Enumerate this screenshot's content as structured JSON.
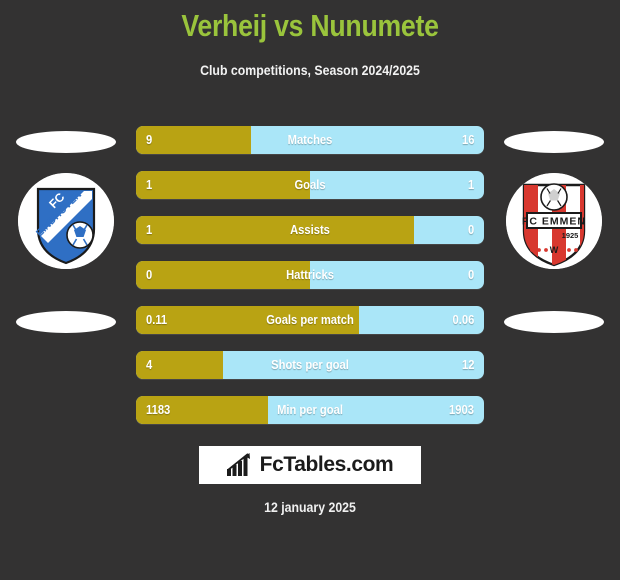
{
  "header": {
    "title": "Verheij vs Nunumete",
    "subtitle": "Club competitions, Season 2024/2025",
    "title_color": "#9ac43c"
  },
  "teams": {
    "left": {
      "name": "FC EINDHOVEN",
      "crest": "fc-eindhoven-crest"
    },
    "right": {
      "name": "FC EMMEN",
      "founded": "1925",
      "crest": "fc-emmen-crest"
    }
  },
  "colors": {
    "background": "#333232",
    "left_bar": "#b9a313",
    "right_bar": "#aae6f8",
    "accent": "#9ac43c"
  },
  "chart_data": {
    "type": "bar",
    "title": "Verheij vs Nunumete",
    "subtitle": "Club competitions, Season 2024/2025",
    "orientation": "horizontal-diverging",
    "series": [
      {
        "name": "Verheij",
        "color": "#b9a313"
      },
      {
        "name": "Nunumete",
        "color": "#aae6f8"
      }
    ],
    "categories": [
      "Matches",
      "Goals",
      "Assists",
      "Hattricks",
      "Goals per match",
      "Shots per goal",
      "Min per goal"
    ],
    "rows": [
      {
        "label": "Matches",
        "left": "9",
        "right": "16",
        "left_pct": 33
      },
      {
        "label": "Goals",
        "left": "1",
        "right": "1",
        "left_pct": 50
      },
      {
        "label": "Assists",
        "left": "1",
        "right": "0",
        "left_pct": 80
      },
      {
        "label": "Hattricks",
        "left": "0",
        "right": "0",
        "left_pct": 50
      },
      {
        "label": "Goals per match",
        "left": "0.11",
        "right": "0.06",
        "left_pct": 64
      },
      {
        "label": "Shots per goal",
        "left": "4",
        "right": "12",
        "left_pct": 25
      },
      {
        "label": "Min per goal",
        "left": "1183",
        "right": "1903",
        "left_pct": 38
      }
    ]
  },
  "footer": {
    "logo_text": "FcTables.com",
    "logo_icon": "bar-chart-icon",
    "date": "12 january 2025"
  }
}
